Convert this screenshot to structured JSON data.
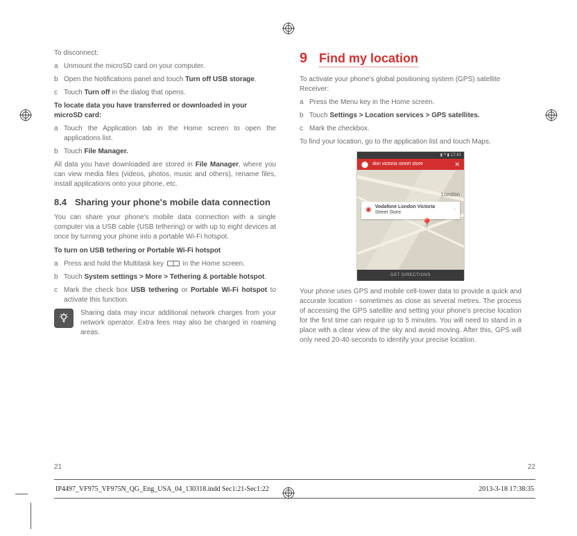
{
  "left": {
    "disconnect_heading": "To disconnect:",
    "disc_a": "Unmount the microSD card on your computer.",
    "disc_b_pre": "Open the Notifications panel and touch ",
    "disc_b_bold": "Turn off USB storage",
    "disc_b_post": ".",
    "disc_c_pre": "Touch ",
    "disc_c_bold": "Turn off",
    "disc_c_post": " in the dialog that opens.",
    "locate_heading": "To locate data you have transferred or downloaded in your microSD card:",
    "loc_a": "Touch the Application tab in the Home screen to open the applications list.",
    "loc_b_pre": "Touch ",
    "loc_b_bold": "File Manager.",
    "loc_para_pre": "All data you have downloaded are stored in ",
    "loc_para_bold": "File Manager",
    "loc_para_post": ", where you can view media files (videos, photos, music and others), rename files, install applications onto your phone, etc.",
    "sect_num": "8.4",
    "sect_title": "Sharing your phone's mobile data connection",
    "sect_para": "You can share your phone's mobile data connection with a single computer via a USB cable (USB tethering) or with up to eight devices at once by turning your phone into a portable Wi-Fi hotspot.",
    "hotspot_heading": "To turn on USB tethering or Portable Wi-Fi hotspot",
    "hot_a_pre": "Press and hold the Multitask key ",
    "hot_a_post": " in the Home screen.",
    "hot_b_pre": "Touch ",
    "hot_b_bold": "System settings > More > Tethering & portable hotspot",
    "hot_b_post": ".",
    "hot_c_pre": "Mark the check box ",
    "hot_c_bold1": "USB tethering",
    "hot_c_mid": " or ",
    "hot_c_bold2": "Portable Wi-Fi hotspot",
    "hot_c_post": " to activate this function.",
    "note": "Sharing data may incur additional network charges from your network operator. Extra fees may also be charged in roaming areas.",
    "pagenum": "21"
  },
  "right": {
    "chap_num": "9",
    "chap_title": "Find my location",
    "intro": "To activate your phone's global positioning system (GPS) satellite Receiver:",
    "r_a": "Press the Menu key in the Home screen.",
    "r_b_pre": "Touch ",
    "r_b_bold": "Settings > Location services > GPS satellites.",
    "r_c": "Mark the checkbox.",
    "r_find": "To find your location, go to the application list and touch Maps.",
    "map": {
      "time": "17:41",
      "search_query": "don victoria street store",
      "city_label": "London",
      "card_line1": "Vodafone London Victoria",
      "card_line2": "Street Store",
      "directions_btn": "GET DIRECTIONS"
    },
    "body_para": "Your phone uses GPS and mobile cell-tower data to provide a quick and accurate location - sometimes as close as several metres. The process of accessing the GPS satellite and setting your phone's precise location for the first time can require up to 5 minutes. You will need to stand in a place with a clear view of the sky and avoid moving. After this, GPS will only need 20-40 seconds to identify your precise location.",
    "pagenum": "22"
  },
  "footer": {
    "file": "IP4497_VF975_VF975N_QG_Eng_USA_04_130318.indd   Sec1:21-Sec1:22",
    "timestamp": "2013-3-18   17:38:35"
  }
}
